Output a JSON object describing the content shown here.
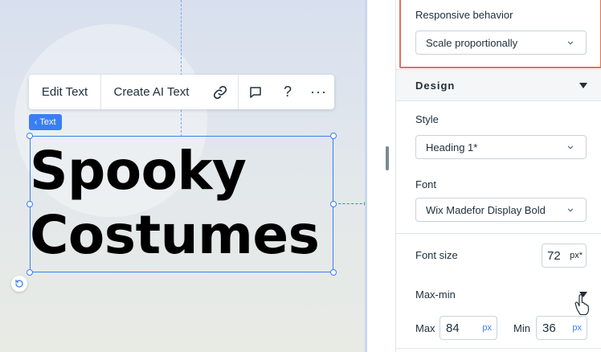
{
  "toolbar": {
    "edit_text": "Edit Text",
    "create_ai_text": "Create AI Text",
    "help": "?",
    "more": "···"
  },
  "element_tag": {
    "label": "Text"
  },
  "heading": {
    "line1": "Spooky",
    "line2": "Costumes"
  },
  "panel": {
    "responsive_label": "Responsive behavior",
    "responsive_value": "Scale proportionally",
    "design_title": "Design",
    "style_label": "Style",
    "style_value": "Heading 1*",
    "font_label": "Font",
    "font_value": "Wix Madefor Display Bold",
    "font_size_label": "Font size",
    "font_size_value": "72",
    "font_size_unit": "px*",
    "maxmin_label": "Max-min",
    "max_label": "Max",
    "max_value": "84",
    "max_unit": "px",
    "min_label": "Min",
    "min_value": "36",
    "min_unit": "px"
  },
  "colors": {
    "accent": "#3a7ef2",
    "highlight_border": "#e0715a",
    "text": "#20303c"
  },
  "icons": [
    "link-icon",
    "comment-icon",
    "chevron-left-icon",
    "chevron-down-icon",
    "triangle-down-icon",
    "rotate-icon",
    "pointer-hand-icon"
  ]
}
